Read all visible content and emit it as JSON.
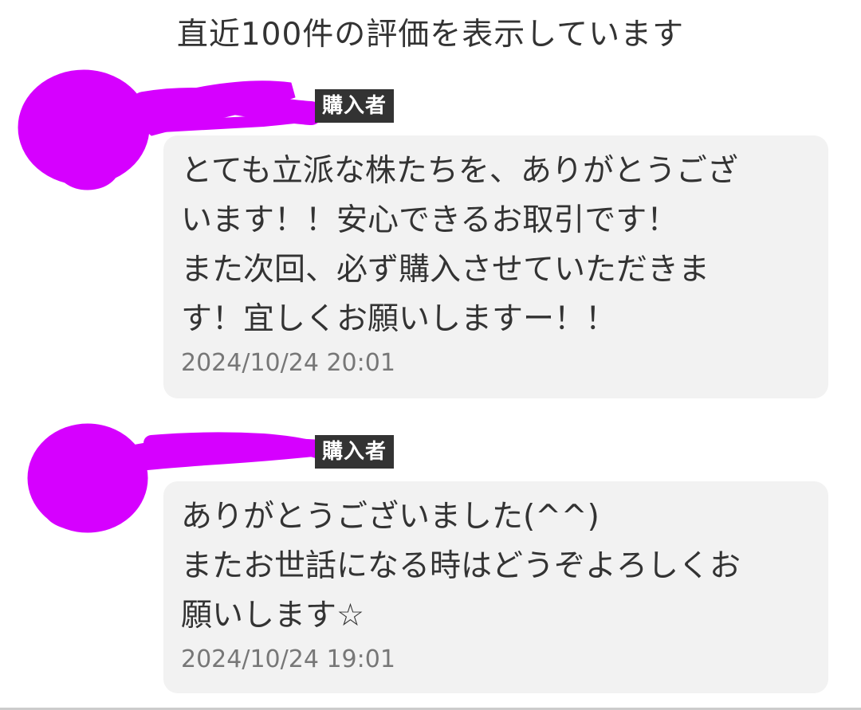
{
  "header": {
    "title": "直近100件の評価を表示しています"
  },
  "reviews": [
    {
      "role_badge": "購入者",
      "comment": "とても立派な株たちを、ありがとうござ\nいます！！安心できるお取引です！\nまた次回、必ず購入させていただきま\nす！宜しくお願いしますー！！",
      "timestamp": "2024/10/24 20:01"
    },
    {
      "role_badge": "購入者",
      "comment": "ありがとうございました(^^)\nまたお世話になる時はどうぞよろしくお\n願いします☆",
      "timestamp": "2024/10/24 19:01"
    }
  ],
  "colors": {
    "redaction": "#d600ff",
    "badge_bg": "#333333",
    "bubble_bg": "#f2f2f2",
    "timestamp": "#777777"
  }
}
